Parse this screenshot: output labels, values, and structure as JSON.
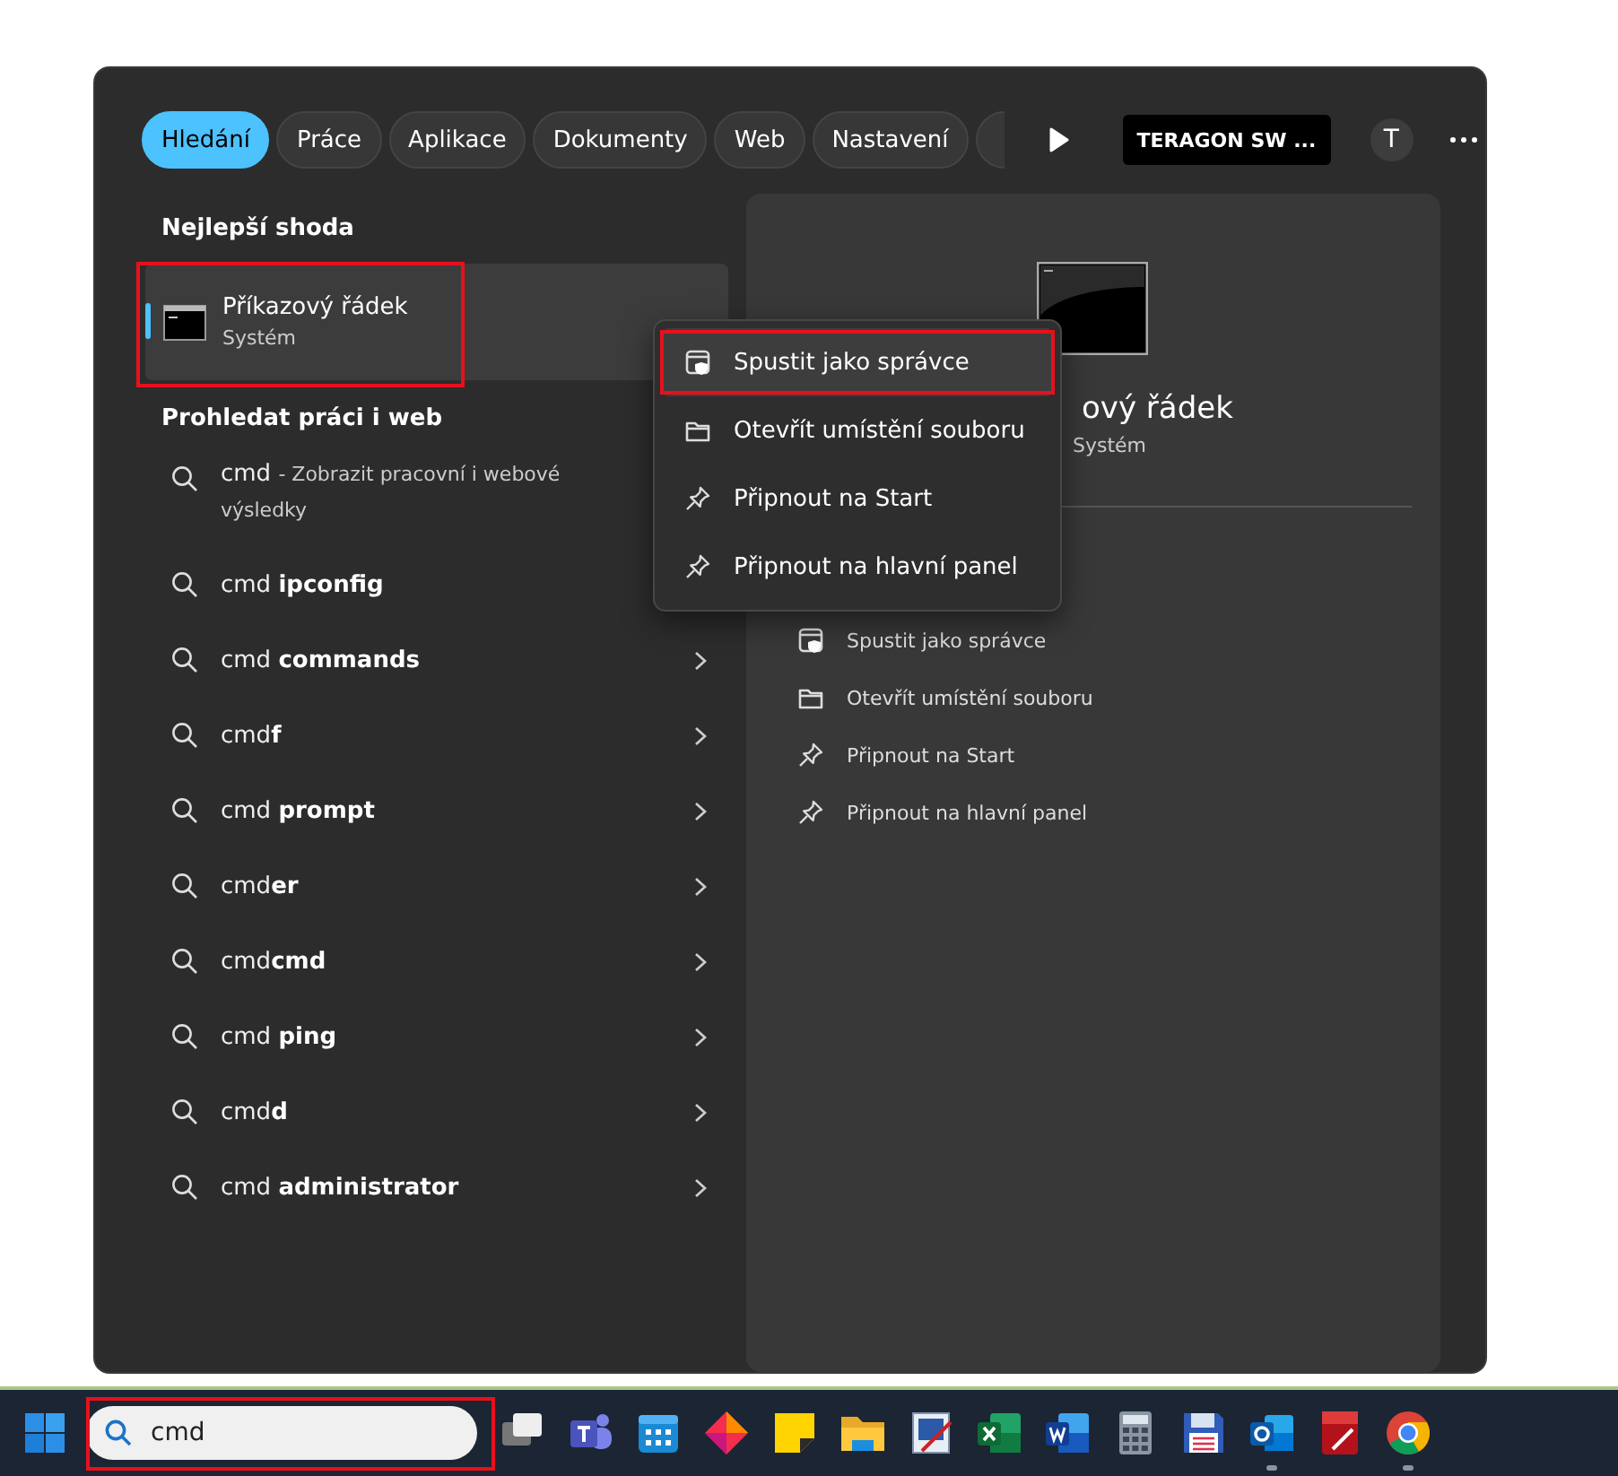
{
  "tabs": [
    {
      "label": "Hledání",
      "selected": true
    },
    {
      "label": "Práce",
      "selected": false
    },
    {
      "label": "Aplikace",
      "selected": false
    },
    {
      "label": "Dokumenty",
      "selected": false
    },
    {
      "label": "Web",
      "selected": false
    },
    {
      "label": "Nastavení",
      "selected": false
    }
  ],
  "account": {
    "label": "TERAGON SW ...",
    "avatar": "T"
  },
  "best_match": {
    "heading": "Nejlepší shoda",
    "title": "Příkazový řádek",
    "subtitle": "Systém",
    "selected": true,
    "annotated": true
  },
  "search_web": {
    "heading": "Prohledat práci i web",
    "suggestions": [
      {
        "query": "cmd",
        "detail": "- Zobrazit pracovní i webové výsledky",
        "has_arrow": false
      },
      {
        "query": "cmd **ipconfig**",
        "has_arrow": false
      },
      {
        "query": "cmd **commands**",
        "has_arrow": true
      },
      {
        "query": "cmd**f**",
        "has_arrow": true
      },
      {
        "query": "cmd **prompt**",
        "has_arrow": true
      },
      {
        "query": "cmd**er**",
        "has_arrow": true
      },
      {
        "query": "cmd**cmd**",
        "has_arrow": true
      },
      {
        "query": "cmd **ping**",
        "has_arrow": true
      },
      {
        "query": "cmd**d**",
        "has_arrow": true
      },
      {
        "query": "cmd **administrator**",
        "has_arrow": true
      }
    ]
  },
  "preview": {
    "title": "ový řádek",
    "subtitle": "Systém",
    "actions": [
      {
        "label": "Spustit jako správce",
        "kind": "shield"
      },
      {
        "label": "Otevřít umístění souboru",
        "kind": "folder"
      },
      {
        "label": "Připnout na Start",
        "kind": "pin"
      },
      {
        "label": "Připnout na hlavní panel",
        "kind": "pin"
      }
    ]
  },
  "context_menu": {
    "items": [
      {
        "label": "Spustit jako správce",
        "kind": "shield",
        "selected": true,
        "annotated": true
      },
      {
        "label": "Otevřít umístění souboru",
        "kind": "folder",
        "selected": false,
        "annotated": false
      },
      {
        "label": "Připnout na Start",
        "kind": "pin",
        "selected": false,
        "annotated": false
      },
      {
        "label": "Připnout na hlavní panel",
        "kind": "pin",
        "selected": false,
        "annotated": false
      }
    ]
  },
  "taskbar": {
    "search": {
      "value": "cmd",
      "annotated": true
    },
    "apps": [
      {
        "kind": "taskview",
        "running": false
      },
      {
        "kind": "teams",
        "running": false
      },
      {
        "kind": "calendar",
        "running": false
      },
      {
        "kind": "diamond",
        "running": false
      },
      {
        "kind": "sticky",
        "running": false
      },
      {
        "kind": "folder",
        "running": false
      },
      {
        "kind": "paint",
        "running": false
      },
      {
        "kind": "excel",
        "running": false
      },
      {
        "kind": "word",
        "running": false
      },
      {
        "kind": "calc",
        "running": false
      },
      {
        "kind": "floppy",
        "running": false
      },
      {
        "kind": "outlook",
        "running": true
      },
      {
        "kind": "pdf",
        "running": false
      },
      {
        "kind": "chrome",
        "running": true
      }
    ]
  }
}
